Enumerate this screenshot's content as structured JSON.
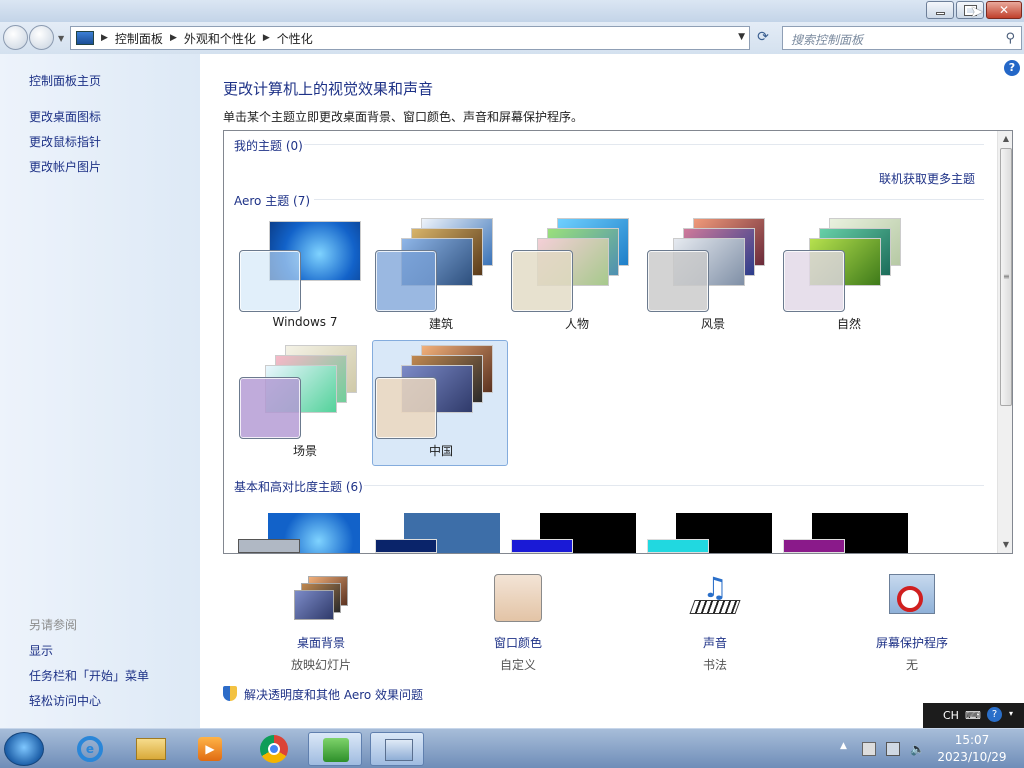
{
  "window": {
    "close_glyph": "✕"
  },
  "address": {
    "crumbs": [
      "控制面板",
      "外观和个性化",
      "个性化"
    ],
    "search_placeholder": "搜索控制面板"
  },
  "sidebar": {
    "home": "控制面板主页",
    "tasks": [
      "更改桌面图标",
      "更改鼠标指针",
      "更改帐户图片"
    ],
    "see_also_label": "另请参阅",
    "see_also": [
      "显示",
      "任务栏和「开始」菜单",
      "轻松访问中心"
    ]
  },
  "main": {
    "title": "更改计算机上的视觉效果和声音",
    "subtitle": "单击某个主题立即更改桌面背景、窗口颜色、声音和屏幕保护程序。",
    "my_themes_label": "我的主题 (0)",
    "online_link": "联机获取更多主题",
    "aero_label": "Aero 主题 (7)",
    "basic_label": "基本和高对比度主题 (6)",
    "aero_themes": [
      "Windows 7",
      "建筑",
      "人物",
      "风景",
      "自然",
      "场景",
      "中国"
    ],
    "selected_theme": "中国",
    "help_glyph": "?"
  },
  "bottom": {
    "items": [
      {
        "label": "桌面背景",
        "value": "放映幻灯片"
      },
      {
        "label": "窗口颜色",
        "value": "自定义"
      },
      {
        "label": "声音",
        "value": "书法"
      },
      {
        "label": "屏幕保护程序",
        "value": "无"
      }
    ],
    "trouble_link": "解决透明度和其他 Aero 效果问题"
  },
  "taskbar": {
    "lang": "CH",
    "time": "15:07",
    "date": "2023/10/29"
  },
  "colors": {
    "link": "#1e3287",
    "selection": "#d9e8f8"
  }
}
